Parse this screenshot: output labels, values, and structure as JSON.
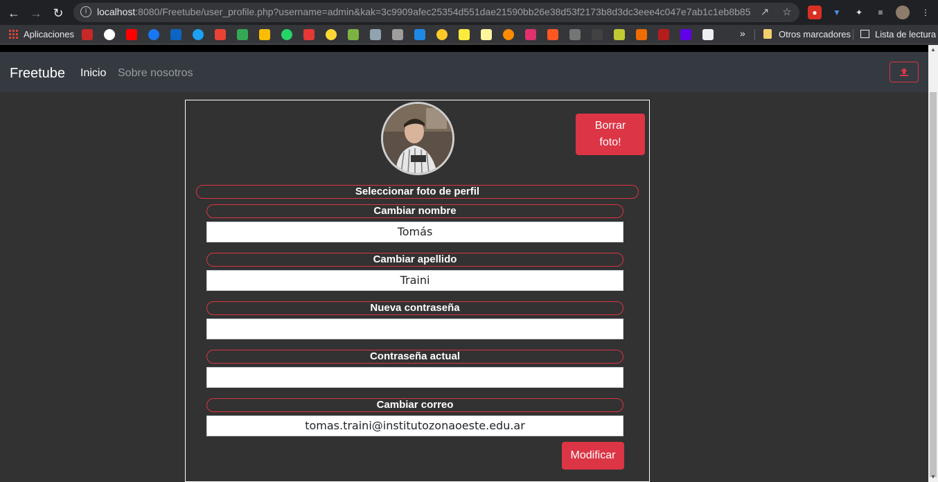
{
  "browser": {
    "url_host": "localhost",
    "url_rest": ":8080/Freetube/user_profile.php?username=admin&kak=3c9909afec25354d551dae21590bb26e38d53f2173b8d3dc3eee4c047e7ab1c1eb8b85...",
    "bookmarks_apps": "Aplicaciones",
    "bookmarks_more": "»",
    "other_bookmarks": "Otros marcadores",
    "reading_list": "Lista de lectura"
  },
  "navbar": {
    "brand": "Freetube",
    "links": [
      "Inicio",
      "Sobre nosotros"
    ],
    "upload_icon": "upload-icon"
  },
  "profile": {
    "delete_photo_label": "Borrar foto!",
    "select_photo_label": "Seleccionar foto de perfil",
    "fields": [
      {
        "label": "Cambiar nombre",
        "value": ""
      },
      {
        "label": "Cambiar apellido",
        "value": ""
      },
      {
        "label": "Nueva contraseña",
        "value": ""
      },
      {
        "label": "Contraseña actual",
        "value": ""
      },
      {
        "label": "Cambiar correo",
        "value": ""
      }
    ],
    "field_values": [
      "Tomás",
      "Traini",
      "",
      "",
      "tomas.traini@institutozonaoeste.edu.ar"
    ],
    "submit_label": "Modificar"
  },
  "colors": {
    "accent": "#dc3545",
    "navbar": "#343a40",
    "page_bg": "#323232"
  }
}
